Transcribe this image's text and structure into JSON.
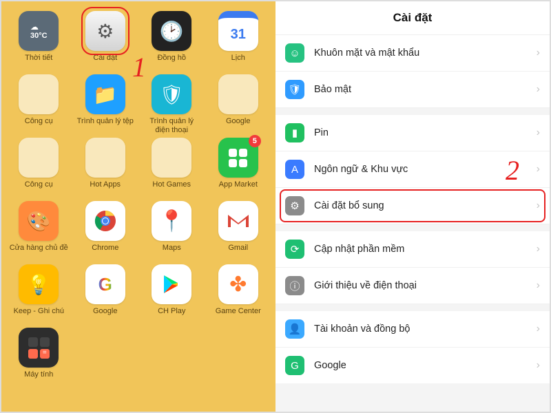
{
  "steps": {
    "one": "1",
    "two": "2"
  },
  "home": {
    "apps": [
      {
        "label": "Thời tiết",
        "icon": "weather"
      },
      {
        "label": "Cài đặt",
        "icon": "settings",
        "highlight": true
      },
      {
        "label": "Đồng hồ",
        "icon": "clock"
      },
      {
        "label": "Lịch",
        "icon": "calendar",
        "badge_text": "31"
      },
      {
        "label": "Công cụ",
        "icon": "folder-tools"
      },
      {
        "label": "Trình quản lý tệp",
        "icon": "files"
      },
      {
        "label": "Trình quản lý điện thoại",
        "icon": "shield"
      },
      {
        "label": "Google",
        "icon": "folder-google"
      },
      {
        "label": "Công cụ",
        "icon": "folder-office"
      },
      {
        "label": "Hot Apps",
        "icon": "folder-hot"
      },
      {
        "label": "Hot Games",
        "icon": "folder-games"
      },
      {
        "label": "App Market",
        "icon": "market",
        "badge": "5"
      },
      {
        "label": "Cửa hàng chủ đề",
        "icon": "palette"
      },
      {
        "label": "Chrome",
        "icon": "chrome"
      },
      {
        "label": "Maps",
        "icon": "maps"
      },
      {
        "label": "Gmail",
        "icon": "gmail"
      },
      {
        "label": "Keep - Ghi chú",
        "icon": "keep"
      },
      {
        "label": "Google",
        "icon": "google"
      },
      {
        "label": "CH Play",
        "icon": "play"
      },
      {
        "label": "Game Center",
        "icon": "gamecenter"
      },
      {
        "label": "Máy tính",
        "icon": "calculator"
      }
    ],
    "weather_temp": "30°C"
  },
  "settings": {
    "title": "Cài đặt",
    "rows": [
      {
        "label": "Khuôn mặt và mật khẩu",
        "color": "#26c281",
        "icon": "face"
      },
      {
        "label": "Bảo mật",
        "color": "#2f9bff",
        "icon": "shield"
      },
      {
        "label": "Pin",
        "color": "#20c060",
        "icon": "battery",
        "gap_before": true
      },
      {
        "label": "Ngôn ngữ & Khu vực",
        "color": "#3a7bff",
        "icon": "lang"
      },
      {
        "label": "Cài đặt bổ sung",
        "color": "#8b8b8b",
        "icon": "gear",
        "highlight": true
      },
      {
        "label": "Cập nhật phần mềm",
        "color": "#1fbf72",
        "icon": "update",
        "gap_before": true
      },
      {
        "label": "Giới thiệu về điện thoại",
        "color": "#8b8b8b",
        "icon": "info"
      },
      {
        "label": "Tài khoản và đồng bộ",
        "color": "#3ba9ff",
        "icon": "user",
        "gap_before": true
      },
      {
        "label": "Google",
        "color": "#1fbf72",
        "icon": "g"
      }
    ]
  }
}
